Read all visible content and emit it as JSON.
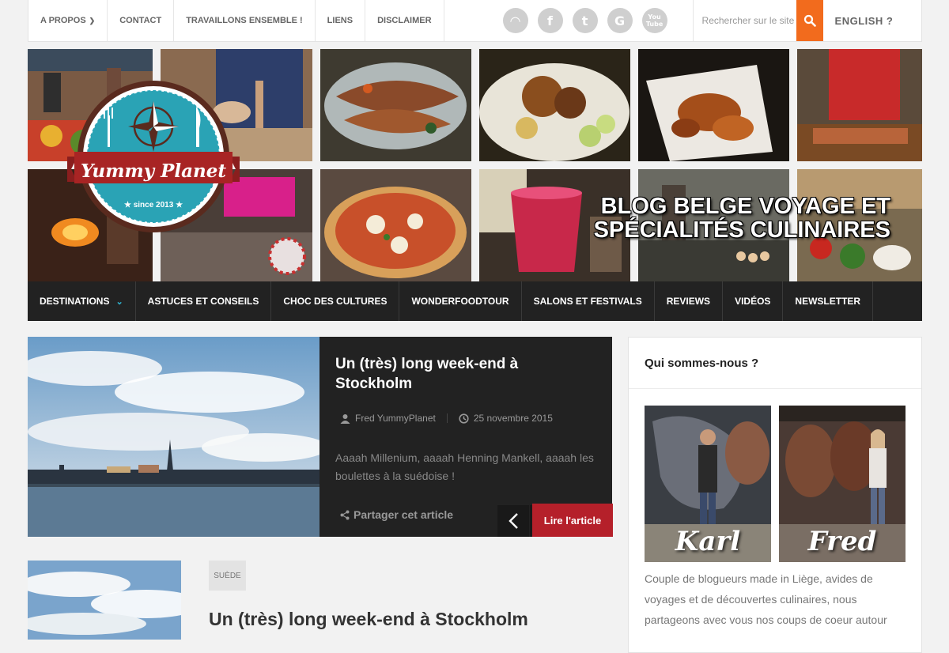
{
  "topbar": {
    "nav": [
      {
        "label": "A propos",
        "has_dropdown": true
      },
      {
        "label": "Contact"
      },
      {
        "label": "Travaillons ensemble !"
      },
      {
        "label": "Liens"
      },
      {
        "label": "Disclaimer"
      }
    ],
    "social": [
      {
        "icon": "rss-icon",
        "glyph": "◠"
      },
      {
        "icon": "facebook-icon",
        "glyph": "f"
      },
      {
        "icon": "twitter-icon",
        "glyph": "t"
      },
      {
        "icon": "google-plus-icon",
        "glyph": "G"
      },
      {
        "icon": "youtube-icon",
        "glyph": "You Tube"
      }
    ],
    "search_placeholder": "Rechercher sur le site",
    "language_link": "ENGLISH ?"
  },
  "banner": {
    "logo_name": "Yummy Planet",
    "logo_since": "★ since 2013 ★",
    "tagline_line1": "BLOG BELGE VOYAGE ET",
    "tagline_line2": "SPÉCIALITÉS CULINAIRES"
  },
  "mainnav": [
    {
      "label": "Destinations",
      "has_dropdown": true
    },
    {
      "label": "Astuces et conseils"
    },
    {
      "label": "Choc des cultures"
    },
    {
      "label": "Wonderfoodtour"
    },
    {
      "label": "Salons et festivals"
    },
    {
      "label": "Reviews"
    },
    {
      "label": "Vidéos"
    },
    {
      "label": "Newsletter"
    }
  ],
  "featured": {
    "title": "Un (très) long week-end à Stockholm",
    "author": "Fred YummyPlanet",
    "date": "25 novembre 2015",
    "excerpt": "Aaaah Millenium, aaaah Henning Mankell, aaaah les boulettes à la suédoise !",
    "share_label": "Partager cet article",
    "read_more": "Lire l'article"
  },
  "post2": {
    "tag": "SUÈDE",
    "title": "Un (très) long week-end à Stockholm"
  },
  "sidebar": {
    "title": "Qui sommes-nous ?",
    "person1": "Karl",
    "person2": "Fred",
    "about": "Couple de blogueurs made in Liège, avides de voyages et de découvertes culinaires, nous partageons avec vous nos coups de coeur autour"
  },
  "colors": {
    "accent_orange": "#f26b1d",
    "nav_dark": "#222222",
    "read_more_red": "#b5202a",
    "logo_teal": "#2aa3b5",
    "logo_brown": "#5a2a1e"
  }
}
